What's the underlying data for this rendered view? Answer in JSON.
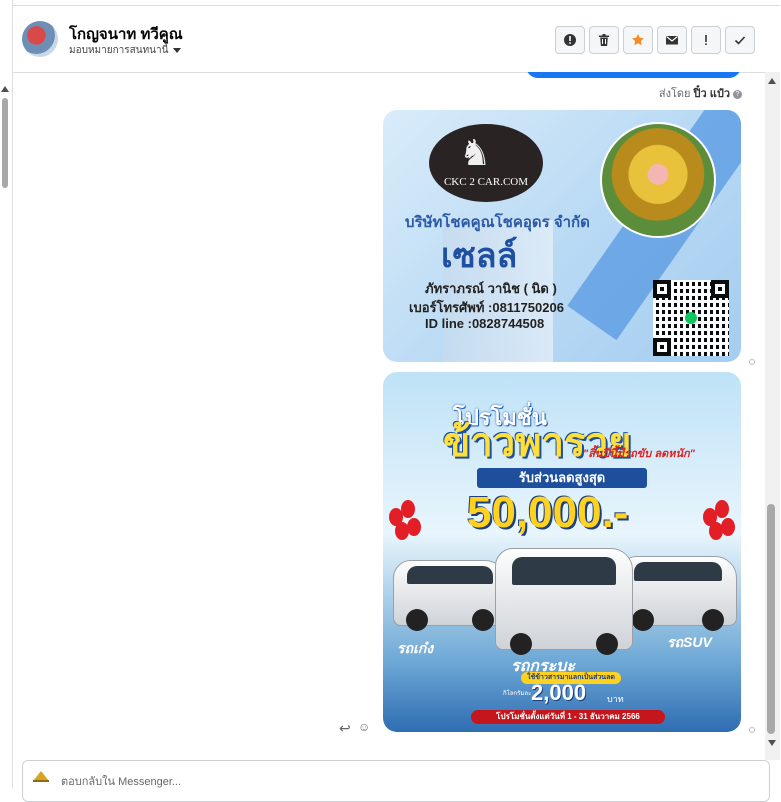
{
  "header": {
    "contact_name": "โกญจนาท ทวีคูณ",
    "assign_label": "มอบหมายการสนทนานี้",
    "actions": [
      {
        "icon": "alert-circle-icon",
        "glyph": "!"
      },
      {
        "icon": "trash-icon",
        "glyph": "🗑"
      },
      {
        "icon": "star-icon",
        "glyph": "★"
      },
      {
        "icon": "envelope-icon",
        "glyph": "✉"
      },
      {
        "icon": "exclamation-icon",
        "glyph": "!"
      },
      {
        "icon": "check-icon",
        "glyph": "✓"
      }
    ]
  },
  "chat": {
    "sent_by_prefix": "ส่งโดย",
    "sent_by_name": "ปิ๋ว แป๋ว",
    "sent_by_help": "?",
    "card1": {
      "logo_text": "CKC 2 CAR.COM",
      "company": "บริษัทโชคคูณโชคอุดร จำกัด",
      "role": "เซลล์",
      "name": "ภัทราภรณ์ วานิช ( นิด )",
      "phone": "เบอร์โทรศัพท์ :0811750206",
      "line_id": "ID line :0828744508"
    },
    "card2": {
      "head": "โปรโมชั่น",
      "title": "ข้าวพารวย",
      "subtitle": "\"สิ้นปีนี้มีรถขับ ลดหนัก\"",
      "ribbon": "รับส่วนลดสูงสุด",
      "amount": "50,000.-",
      "sedan": "รถเก๋ง",
      "suv": "รถSUV",
      "pickup": "รถกระบะ",
      "rice_note": "ใช้ข้าวสารมาแลกเป็นส่วนลด",
      "per_kg": "กิโลกรัมละ",
      "price": "2,000",
      "baht": "บาท",
      "period": "โปรโมชั่นตั้งแต่วันที่ 1 - 31 ธันวาคม 2566"
    }
  },
  "reply_box": {
    "placeholder": "ตอบกลับใน Messenger..."
  },
  "colors": {
    "accent": "#1877f2",
    "star": "#f28c28"
  }
}
